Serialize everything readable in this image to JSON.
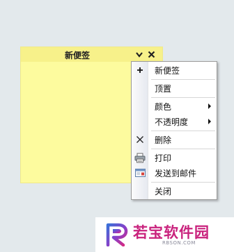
{
  "note": {
    "title": "新便签",
    "background_color": "#fdfb9e",
    "header_icons": [
      "chevron-down-icon",
      "close-icon"
    ]
  },
  "context_menu": {
    "items": [
      {
        "label": "新便签",
        "icon": "plus-icon"
      },
      {
        "label": "顶置",
        "icon": ""
      },
      {
        "label": "颜色",
        "icon": "",
        "submenu": true
      },
      {
        "label": "不透明度",
        "icon": "",
        "submenu": true
      },
      {
        "label": "删除",
        "icon": "close-icon"
      },
      {
        "label": "打印",
        "icon": "printer-icon"
      },
      {
        "label": "发送到邮件",
        "icon": "mail-icon"
      },
      {
        "label": "关闭",
        "icon": ""
      }
    ]
  },
  "watermark": {
    "name": "若宝软件园",
    "url": "RBSON.COM",
    "brand_color": "#c9227d"
  }
}
